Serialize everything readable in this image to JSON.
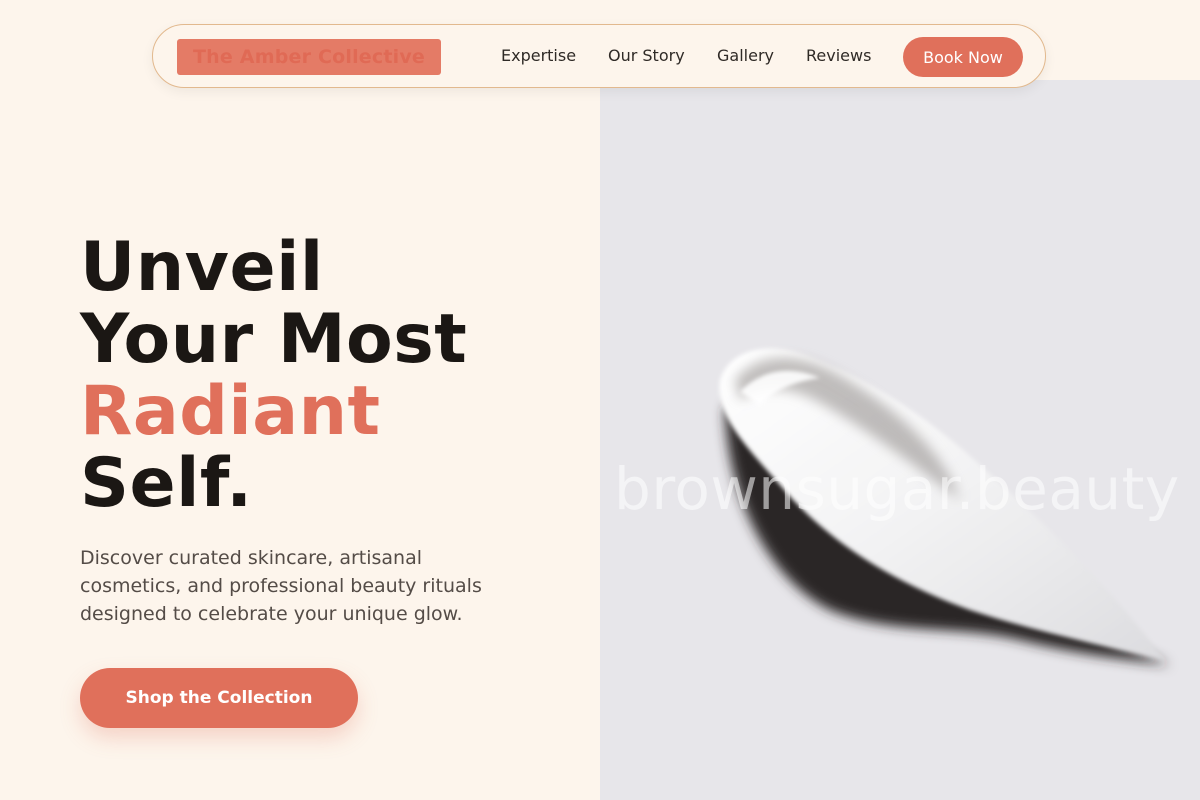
{
  "header": {
    "logo_text": "The Amber Collective",
    "nav_links": [
      "Expertise",
      "Our Story",
      "Gallery",
      "Reviews"
    ],
    "cta_label": "Book Now"
  },
  "hero": {
    "headline_lines": [
      "Unveil",
      "Your Most",
      "Radiant",
      "Self."
    ],
    "subtext": "Discover curated skincare, artisanal cosmetics, and professional beauty rituals designed to celebrate your unique glow.",
    "cta_label": "Shop the Collection"
  },
  "image": {
    "watermark": "brownsugar.beauty"
  },
  "colors": {
    "accent": "#e0705b",
    "background": "#fdf5ec",
    "image_background": "#e7e6ea",
    "text_dark": "#1b1714"
  }
}
